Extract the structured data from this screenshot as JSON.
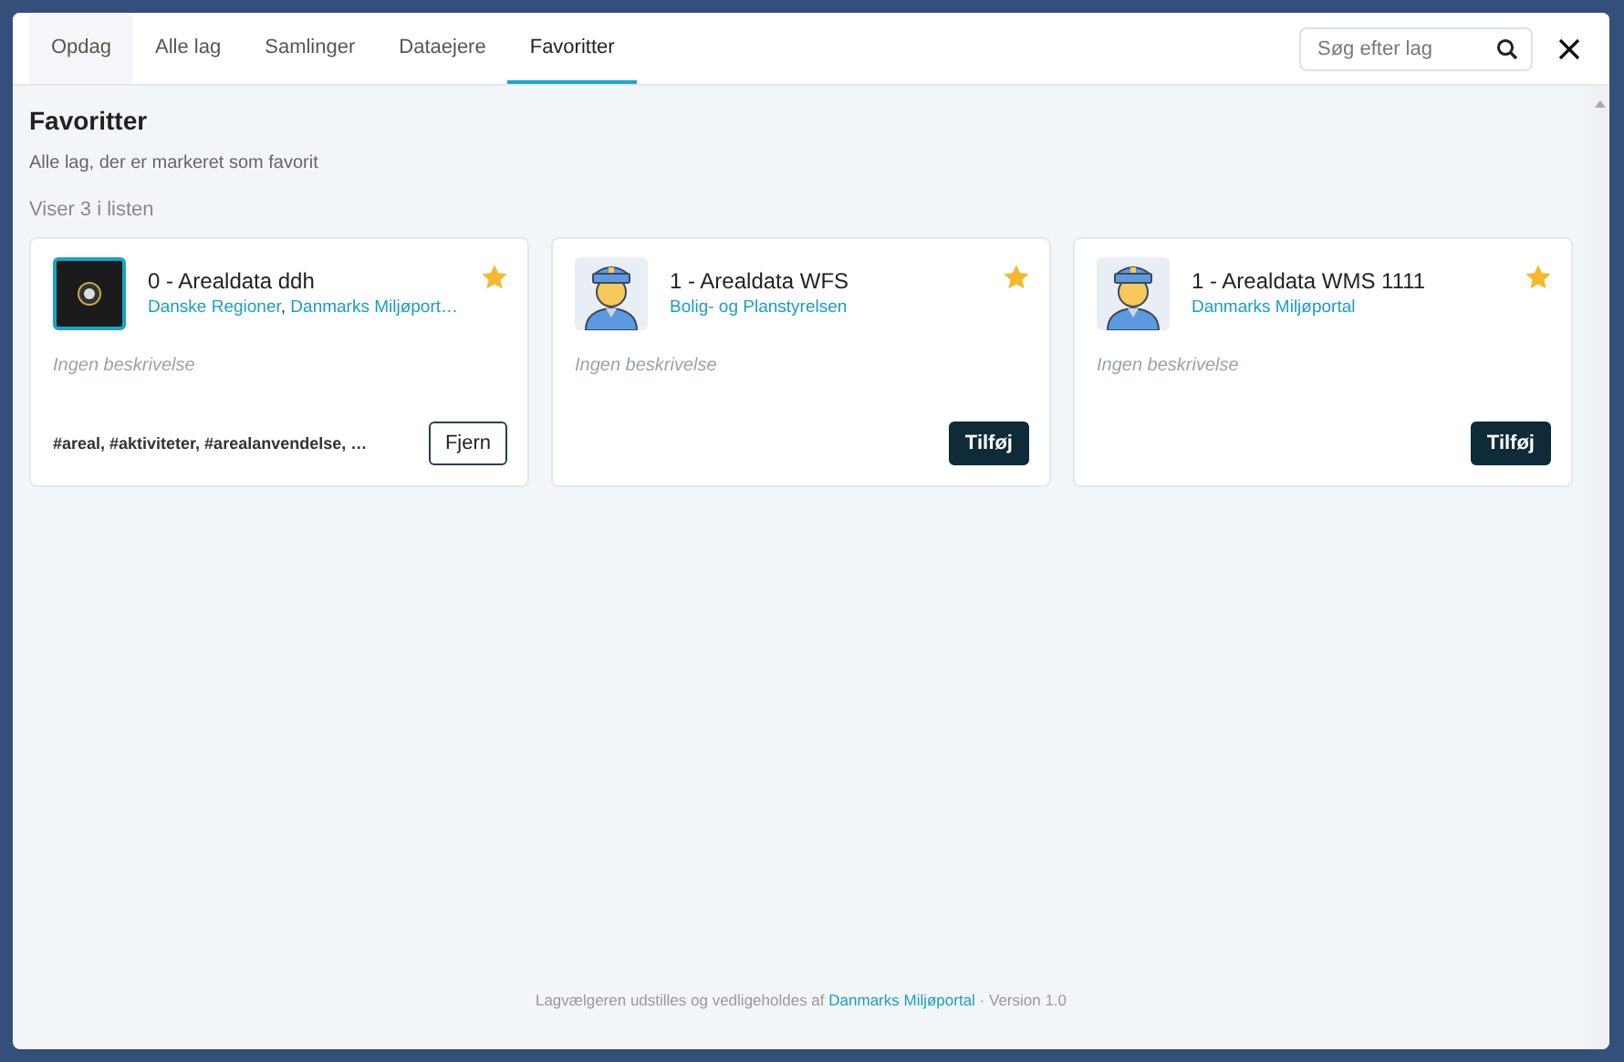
{
  "tabs": [
    {
      "label": "Opdag",
      "selected": false
    },
    {
      "label": "Alle lag",
      "selected": false
    },
    {
      "label": "Samlinger",
      "selected": false
    },
    {
      "label": "Dataejere",
      "selected": false
    },
    {
      "label": "Favoritter",
      "selected": true
    }
  ],
  "search": {
    "placeholder": "Søg efter lag"
  },
  "heading": "Favoritter",
  "subtitle": "Alle lag, der er markeret som favorit",
  "count": "Viser 3 i listen",
  "cards": [
    {
      "kind": "logo",
      "title": "0 - Arealdata ddh",
      "owners": [
        "Danske Regioner",
        "Danmarks Miljøport…"
      ],
      "owner_separator": ",",
      "description": "Ingen beskrivelse",
      "starred": true,
      "tags": "#areal, #aktiviteter, #arealanvendelse, …",
      "in_list": true,
      "button": "Fjern"
    },
    {
      "kind": "avatar",
      "title": "1 - Arealdata WFS",
      "owners": [
        "Bolig- og Planstyrelsen"
      ],
      "description": "Ingen beskrivelse",
      "starred": true,
      "in_list": false,
      "button": "Tilføj"
    },
    {
      "kind": "avatar",
      "title": "1 - Arealdata WMS 1111",
      "owners": [
        "Danmarks Miljøportal"
      ],
      "description": "Ingen beskrivelse",
      "starred": true,
      "in_list": false,
      "button": "Tilføj"
    }
  ],
  "footer": {
    "text": "Lagvælgeren udstilles og vedligeholdes af",
    "link": "Danmarks Miljøportal",
    "version": "· Version 1.0"
  }
}
